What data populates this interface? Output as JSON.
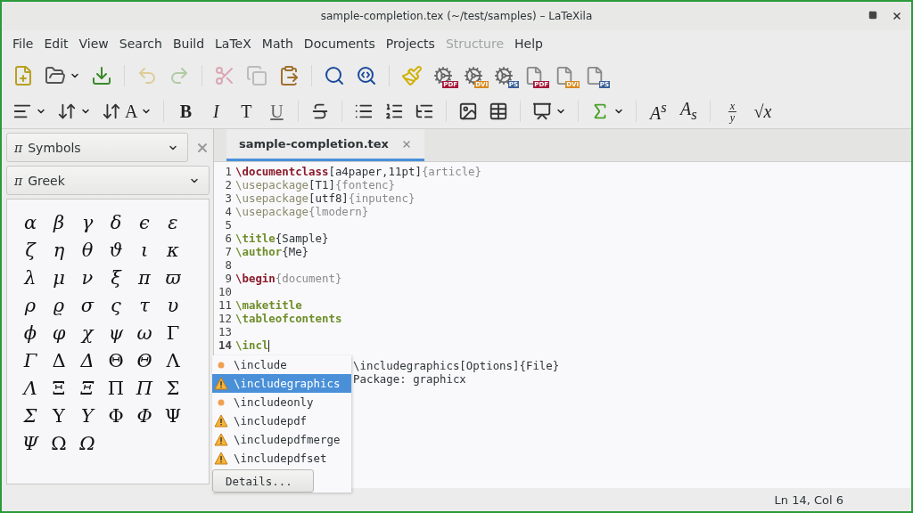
{
  "window": {
    "title": "sample-completion.tex (~/test/samples) – LaTeXila"
  },
  "menu": [
    {
      "label": "File",
      "disabled": false
    },
    {
      "label": "Edit",
      "disabled": false
    },
    {
      "label": "View",
      "disabled": false
    },
    {
      "label": "Search",
      "disabled": false
    },
    {
      "label": "Build",
      "disabled": false
    },
    {
      "label": "LaTeX",
      "disabled": false
    },
    {
      "label": "Math",
      "disabled": false
    },
    {
      "label": "Documents",
      "disabled": false
    },
    {
      "label": "Projects",
      "disabled": false
    },
    {
      "label": "Structure",
      "disabled": true
    },
    {
      "label": "Help",
      "disabled": false
    }
  ],
  "toolbar": [
    {
      "items": [
        {
          "kind": "new",
          "disabled": false
        },
        {
          "kind": "open",
          "disabled": false,
          "dropdown": true
        },
        {
          "kind": "save",
          "disabled": false
        }
      ]
    },
    {
      "items": [
        {
          "kind": "undo",
          "disabled": true
        },
        {
          "kind": "redo",
          "disabled": true
        }
      ]
    },
    {
      "items": [
        {
          "kind": "cut",
          "disabled": true
        },
        {
          "kind": "copy",
          "disabled": true
        },
        {
          "kind": "paste",
          "disabled": false
        }
      ]
    },
    {
      "items": [
        {
          "kind": "search",
          "disabled": false
        },
        {
          "kind": "replace",
          "disabled": false
        }
      ]
    },
    {
      "items": [
        {
          "kind": "clean",
          "disabled": false
        },
        {
          "kind": "compile",
          "badge": "PDF",
          "color": "#a8183a",
          "disabled": false
        },
        {
          "kind": "compile",
          "badge": "DVI",
          "color": "#d98a1e",
          "disabled": false
        },
        {
          "kind": "compile",
          "badge": "PS",
          "color": "#3a5f9a",
          "disabled": false
        },
        {
          "kind": "view",
          "badge": "PDF",
          "color": "#a8183a",
          "disabled": false
        },
        {
          "kind": "view",
          "badge": "DVI",
          "color": "#d98a1e",
          "disabled": false
        },
        {
          "kind": "view",
          "badge": "PS",
          "color": "#3a5f9a",
          "disabled": false
        }
      ]
    }
  ],
  "format_toolbar": [
    {
      "items": [
        {
          "kind": "align",
          "dropdown": true
        },
        {
          "kind": "spacing",
          "dropdown": true
        },
        {
          "kind": "size",
          "label": "A",
          "dropdown": true
        }
      ]
    },
    {
      "items": [
        {
          "kind": "bold",
          "label": "B"
        },
        {
          "kind": "italic",
          "label": "I"
        },
        {
          "kind": "typewriter",
          "label": "T"
        },
        {
          "kind": "underline",
          "label": "U"
        }
      ]
    },
    {
      "items": [
        {
          "kind": "strike"
        }
      ]
    },
    {
      "items": [
        {
          "kind": "bullets"
        },
        {
          "kind": "numbers"
        },
        {
          "kind": "description"
        }
      ]
    },
    {
      "items": [
        {
          "kind": "image"
        },
        {
          "kind": "table"
        }
      ]
    },
    {
      "items": [
        {
          "kind": "presentation",
          "dropdown": true
        }
      ]
    },
    {
      "items": [
        {
          "kind": "sum",
          "dropdown": true
        }
      ]
    },
    {
      "items": [
        {
          "kind": "math",
          "label": "A$^{s}$"
        },
        {
          "kind": "math",
          "label": "A$_{s}$"
        }
      ]
    },
    {
      "items": [
        {
          "kind": "fraction",
          "top": "x",
          "bottom": "y"
        },
        {
          "kind": "math",
          "label": "√x"
        }
      ]
    }
  ],
  "side_panel": {
    "selector": {
      "icon": "π",
      "label": "Symbols"
    },
    "category": {
      "icon": "π",
      "label": "Greek"
    },
    "symbols": [
      {
        "symbol": "α",
        "italic": true
      },
      {
        "symbol": "β",
        "italic": true
      },
      {
        "symbol": "γ",
        "italic": true
      },
      {
        "symbol": "δ",
        "italic": true
      },
      {
        "symbol": "ϵ",
        "italic": true
      },
      {
        "symbol": "ε",
        "italic": true
      },
      {
        "symbol": "ζ",
        "italic": true
      },
      {
        "symbol": "η",
        "italic": true
      },
      {
        "symbol": "θ",
        "italic": true
      },
      {
        "symbol": "ϑ",
        "italic": true
      },
      {
        "symbol": "ι",
        "italic": true
      },
      {
        "symbol": "κ",
        "italic": true
      },
      {
        "symbol": "λ",
        "italic": true
      },
      {
        "symbol": "μ",
        "italic": true
      },
      {
        "symbol": "ν",
        "italic": true
      },
      {
        "symbol": "ξ",
        "italic": true
      },
      {
        "symbol": "π",
        "italic": true
      },
      {
        "symbol": "ϖ",
        "italic": true
      },
      {
        "symbol": "ρ",
        "italic": true
      },
      {
        "symbol": "ϱ",
        "italic": true
      },
      {
        "symbol": "σ",
        "italic": true
      },
      {
        "symbol": "ς",
        "italic": true
      },
      {
        "symbol": "τ",
        "italic": true
      },
      {
        "symbol": "υ",
        "italic": true
      },
      {
        "symbol": "ϕ",
        "italic": true
      },
      {
        "symbol": "φ",
        "italic": true
      },
      {
        "symbol": "χ",
        "italic": true
      },
      {
        "symbol": "ψ",
        "italic": true
      },
      {
        "symbol": "ω",
        "italic": true
      },
      {
        "symbol": "Γ",
        "italic": false
      },
      {
        "symbol": "Γ",
        "italic": true
      },
      {
        "symbol": "Δ",
        "italic": false
      },
      {
        "symbol": "Δ",
        "italic": true
      },
      {
        "symbol": "Θ",
        "italic": false
      },
      {
        "symbol": "Θ",
        "italic": true
      },
      {
        "symbol": "Λ",
        "italic": false
      },
      {
        "symbol": "Λ",
        "italic": true
      },
      {
        "symbol": "Ξ",
        "italic": false
      },
      {
        "symbol": "Ξ",
        "italic": true
      },
      {
        "symbol": "Π",
        "italic": false
      },
      {
        "symbol": "Π",
        "italic": true
      },
      {
        "symbol": "Σ",
        "italic": false
      },
      {
        "symbol": "Σ",
        "italic": true
      },
      {
        "symbol": "Υ",
        "italic": false
      },
      {
        "symbol": "Υ",
        "italic": true
      },
      {
        "symbol": "Φ",
        "italic": false
      },
      {
        "symbol": "Φ",
        "italic": true
      },
      {
        "symbol": "Ψ",
        "italic": false
      },
      {
        "symbol": "Ψ",
        "italic": true
      },
      {
        "symbol": "Ω",
        "italic": false
      },
      {
        "symbol": "Ω",
        "italic": true
      }
    ]
  },
  "tabs": [
    {
      "label": "sample-completion.tex",
      "selected": true
    }
  ],
  "editor": {
    "lines": [
      {
        "number": "1",
        "current": false,
        "segments": [
          {
            "kind": "keyword",
            "text": "\\documentclass"
          },
          {
            "kind": "plain",
            "text": "[a4paper,11pt]"
          },
          {
            "kind": "argument",
            "text": "{article}"
          }
        ]
      },
      {
        "number": "2",
        "current": false,
        "segments": [
          {
            "kind": "command",
            "text": "\\usepackage"
          },
          {
            "kind": "plain",
            "text": "[T1]"
          },
          {
            "kind": "argument",
            "text": "{fontenc}"
          }
        ]
      },
      {
        "number": "3",
        "current": false,
        "segments": [
          {
            "kind": "command",
            "text": "\\usepackage"
          },
          {
            "kind": "plain",
            "text": "[utf8]"
          },
          {
            "kind": "argument",
            "text": "{inputenc}"
          }
        ]
      },
      {
        "number": "4",
        "current": false,
        "segments": [
          {
            "kind": "command",
            "text": "\\usepackage"
          },
          {
            "kind": "argument",
            "text": "{lmodern}"
          }
        ]
      },
      {
        "number": "5",
        "current": false
      },
      {
        "number": "6",
        "current": false,
        "segments": [
          {
            "kind": "title",
            "text": "\\title"
          },
          {
            "kind": "plain",
            "text": "{Sample}"
          }
        ]
      },
      {
        "number": "7",
        "current": false,
        "segments": [
          {
            "kind": "title",
            "text": "\\author"
          },
          {
            "kind": "plain",
            "text": "{Me}"
          }
        ]
      },
      {
        "number": "8",
        "current": false
      },
      {
        "number": "9",
        "current": false,
        "segments": [
          {
            "kind": "keyword",
            "text": "\\begin"
          },
          {
            "kind": "argument",
            "text": "{document}"
          }
        ]
      },
      {
        "number": "10",
        "current": false
      },
      {
        "number": "11",
        "current": false,
        "segments": [
          {
            "kind": "title",
            "text": "\\maketitle"
          }
        ]
      },
      {
        "number": "12",
        "current": false,
        "segments": [
          {
            "kind": "title",
            "text": "\\tableofcontents"
          }
        ]
      },
      {
        "number": "13",
        "current": false
      },
      {
        "number": "14",
        "current": true,
        "segments": [
          {
            "kind": "title",
            "text": "\\incl"
          }
        ]
      }
    ]
  },
  "completion": {
    "items": [
      {
        "kind": "word",
        "label": "\\include",
        "selected": false
      },
      {
        "kind": "warning",
        "label": "\\includegraphics",
        "selected": true
      },
      {
        "kind": "word",
        "label": "\\includeonly",
        "selected": false
      },
      {
        "kind": "warning",
        "label": "\\includepdf",
        "selected": false
      },
      {
        "kind": "warning",
        "label": "\\includepdfmerge",
        "selected": false
      },
      {
        "kind": "warning",
        "label": "\\includepdfset",
        "selected": false
      }
    ],
    "details_button": "Details...",
    "info": [
      "\\includegraphics[Options]{File}",
      "Package: graphicx"
    ]
  },
  "status_bar": {
    "position": "Ln 14, Col 6"
  }
}
